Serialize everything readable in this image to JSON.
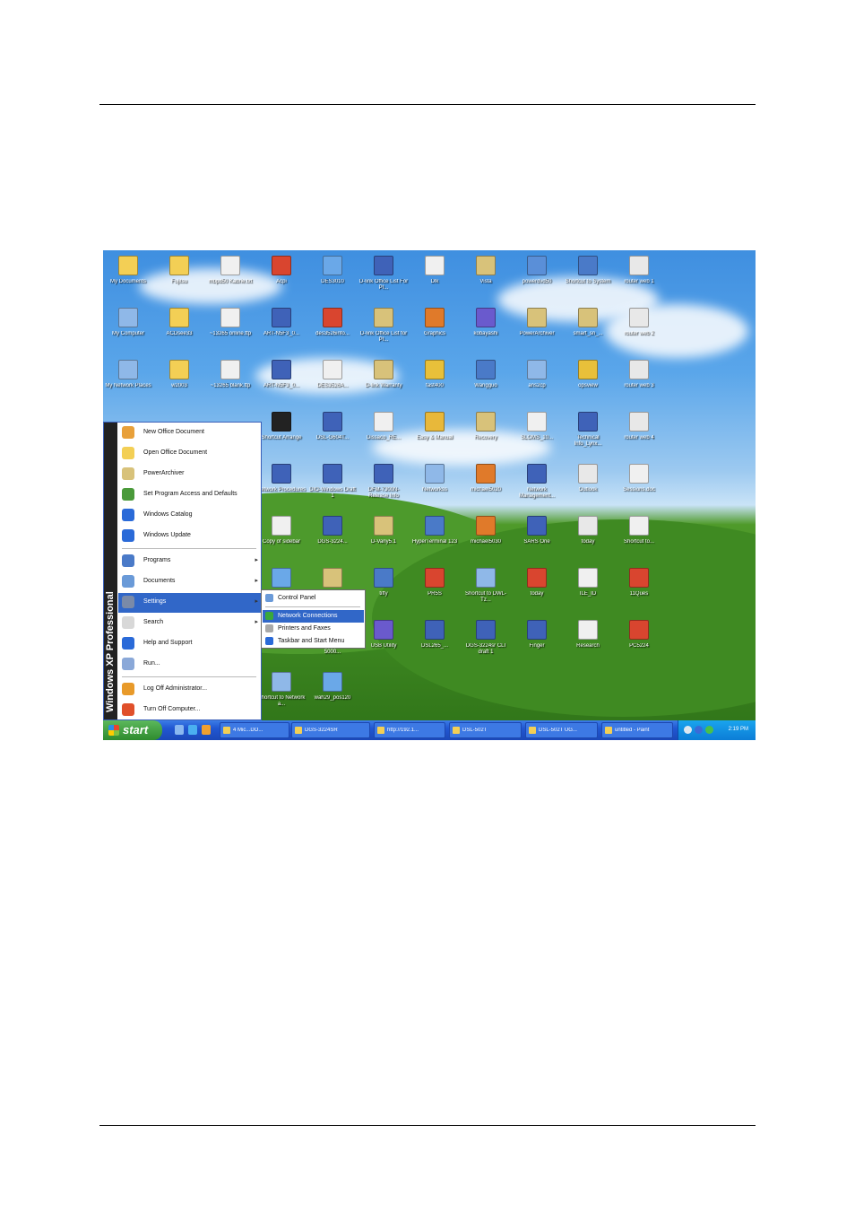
{
  "colors": {
    "desktop_sky": "#4a98e6",
    "desktop_grass": "#3f8a22",
    "taskbar": "#2157d2",
    "start_green": "#3f9e3f",
    "highlight": "#3167c8"
  },
  "desktop_icons": [
    {
      "label": "My Documents",
      "icon": "folder-icon",
      "color": "#f3cf55"
    },
    {
      "label": "Fujitsu",
      "icon": "folder-icon",
      "color": "#f3cf55"
    },
    {
      "label": "mbpd50 Kabrie.txt",
      "icon": "text-file-icon",
      "color": "#f0f0f0"
    },
    {
      "label": "Acpi",
      "icon": "pdf-icon",
      "color": "#d9452f"
    },
    {
      "label": "DES3010",
      "icon": "shortcut-icon",
      "color": "#6aa8e8"
    },
    {
      "label": "D-link Office List For PI...",
      "icon": "word-doc-icon",
      "color": "#3f62b8"
    },
    {
      "label": "Dlk",
      "icon": "text-file-icon",
      "color": "#f0f0f0"
    },
    {
      "label": "Vista",
      "icon": "image-icon",
      "color": "#d8c27a"
    },
    {
      "label": "powerdvd50",
      "icon": "app-icon",
      "color": "#5a8fd8"
    },
    {
      "label": "Shortcut to System",
      "icon": "monitor-icon",
      "color": "#4a7ac8"
    },
    {
      "label": "router web 1",
      "icon": "paint-icon",
      "color": "#e8e8e8"
    },
    {
      "label": "My Computer",
      "icon": "computer-icon",
      "color": "#8fb8e8"
    },
    {
      "label": "ACDsee33",
      "icon": "folder-icon",
      "color": "#f3cf55"
    },
    {
      "label": "~13265 online.ttp",
      "icon": "text-file-icon",
      "color": "#f0f0f0"
    },
    {
      "label": "ART-N5F3_0...",
      "icon": "word-doc-icon",
      "color": "#3f62b8"
    },
    {
      "label": "des3526info...",
      "icon": "pdf-icon",
      "color": "#d9452f"
    },
    {
      "label": "D-link Office List for PI...",
      "icon": "image-icon",
      "color": "#d8c27a"
    },
    {
      "label": "Graphics",
      "icon": "app-icon",
      "color": "#e07a2a"
    },
    {
      "label": "kobayashi",
      "icon": "app-icon",
      "color": "#6a5acd"
    },
    {
      "label": "PowerArchiver",
      "icon": "archive-icon",
      "color": "#d8c27a"
    },
    {
      "label": "smart_sn_...",
      "icon": "image-icon",
      "color": "#d8c27a"
    },
    {
      "label": "router web 2",
      "icon": "paint-icon",
      "color": "#e8e8e8"
    },
    {
      "label": "My Network Places",
      "icon": "network-icon",
      "color": "#8fb8e8"
    },
    {
      "label": "w2003",
      "icon": "folder-icon",
      "color": "#f3cf55"
    },
    {
      "label": "~13265 blank.ttp",
      "icon": "text-file-icon",
      "color": "#f0f0f0"
    },
    {
      "label": "ART-N5F3_0...",
      "icon": "word-doc-icon",
      "color": "#3f62b8"
    },
    {
      "label": "DES3526A...",
      "icon": "text-file-icon",
      "color": "#f0f0f0"
    },
    {
      "label": "D-link Warranty",
      "icon": "image-icon",
      "color": "#d8c27a"
    },
    {
      "label": "fast400",
      "icon": "app-icon",
      "color": "#e8c03a"
    },
    {
      "label": "Wangguo",
      "icon": "app-icon",
      "color": "#4a7ac8"
    },
    {
      "label": "ans2cp",
      "icon": "app-icon",
      "color": "#8fb8e8"
    },
    {
      "label": "opsview",
      "icon": "app-icon",
      "color": "#e8c03a"
    },
    {
      "label": "router web 3",
      "icon": "paint-icon",
      "color": "#e8e8e8"
    },
    {
      "label": "Shortcut Arrange",
      "icon": "cmd-icon",
      "color": "#222222"
    },
    {
      "label": "DSL-G604T...",
      "icon": "word-doc-icon",
      "color": "#3f62b8"
    },
    {
      "label": "Dissaco_RE...",
      "icon": "text-file-icon",
      "color": "#f0f0f0"
    },
    {
      "label": "Easy & Manual",
      "icon": "app-icon",
      "color": "#e8b83a"
    },
    {
      "label": "Recovery",
      "icon": "image-icon",
      "color": "#d8c27a"
    },
    {
      "label": "SLOMS_10...",
      "icon": "text-file-icon",
      "color": "#f0f0f0"
    },
    {
      "label": "Technical Info_Lynx...",
      "icon": "word-doc-icon",
      "color": "#3f62b8"
    },
    {
      "label": "router web 4",
      "icon": "paint-icon",
      "color": "#e8e8e8"
    },
    {
      "label": "Network Procedures",
      "icon": "word-doc-icon",
      "color": "#3f62b8"
    },
    {
      "label": "DIO-Windows Draft 1",
      "icon": "word-doc-icon",
      "color": "#3f62b8"
    },
    {
      "label": "DFM-7300N-Release Info",
      "icon": "word-doc-icon",
      "color": "#3f62b8"
    },
    {
      "label": "Networkss",
      "icon": "network-icon",
      "color": "#8fb8e8"
    },
    {
      "label": "michael5020",
      "icon": "app-icon",
      "color": "#e07a2a"
    },
    {
      "label": "Network Management...",
      "icon": "word-doc-icon",
      "color": "#3f62b8"
    },
    {
      "label": "Outlook",
      "icon": "paint-icon",
      "color": "#e8e8e8"
    },
    {
      "label": "Sessions.doc",
      "icon": "text-file-icon",
      "color": "#f0f0f0"
    },
    {
      "label": "Copy of sidebar",
      "icon": "text-file-icon",
      "color": "#f0f0f0"
    },
    {
      "label": "DGS-3224...",
      "icon": "word-doc-icon",
      "color": "#3f62b8"
    },
    {
      "label": "D-Vany5.1",
      "icon": "image-icon",
      "color": "#d8c27a"
    },
    {
      "label": "HyperTerminal 123",
      "icon": "app-icon",
      "color": "#4a7ac8"
    },
    {
      "label": "michael5030",
      "icon": "app-icon",
      "color": "#e07a2a"
    },
    {
      "label": "SARS One",
      "icon": "word-doc-icon",
      "color": "#3f62b8"
    },
    {
      "label": "today",
      "icon": "paint-icon",
      "color": "#e8e8e8"
    },
    {
      "label": "Shortcut to...",
      "icon": "text-file-icon",
      "color": "#f0f0f0"
    },
    {
      "label": "DES-3226...",
      "icon": "shortcut-icon",
      "color": "#6aa8e8"
    },
    {
      "label": "DSL-G604E",
      "icon": "image-icon",
      "color": "#d8c27a"
    },
    {
      "label": "tiffy",
      "icon": "app-icon",
      "color": "#4a7ac8"
    },
    {
      "label": "PR5S",
      "icon": "pdf-icon",
      "color": "#d9452f"
    },
    {
      "label": "Shortcut to DWL-Tz...",
      "icon": "network-icon",
      "color": "#8fb8e8"
    },
    {
      "label": "today",
      "icon": "pdf-icon",
      "color": "#d9452f"
    },
    {
      "label": "ILE_ID",
      "icon": "text-file-icon",
      "color": "#f0f0f0"
    },
    {
      "label": "11Ques",
      "icon": "pdf-icon",
      "color": "#d9452f"
    },
    {
      "label": "PC5240",
      "icon": "pdf-icon",
      "color": "#d9452f"
    },
    {
      "label": "Shortcut to DWL-5000...",
      "icon": "folder-icon",
      "color": "#f3cf55"
    },
    {
      "label": "USB Utility",
      "icon": "app-icon",
      "color": "#6a5acd"
    },
    {
      "label": "DSL265_...",
      "icon": "word-doc-icon",
      "color": "#3f62b8"
    },
    {
      "label": "DGS-3224sr CLI draft 1",
      "icon": "word-doc-icon",
      "color": "#3f62b8"
    },
    {
      "label": "Finger",
      "icon": "word-doc-icon",
      "color": "#3f62b8"
    },
    {
      "label": "Research",
      "icon": "text-file-icon",
      "color": "#f0f0f0"
    },
    {
      "label": "PC5224",
      "icon": "pdf-icon",
      "color": "#d9452f"
    },
    {
      "label": "Shortcut to Network a...",
      "icon": "network-icon",
      "color": "#8fb8e8"
    },
    {
      "label": "wah29_pos120",
      "icon": "shortcut-icon",
      "color": "#6aa8e8"
    }
  ],
  "start_menu": {
    "band_label": "Windows XP Professional",
    "items": [
      {
        "label": "New Office Document",
        "icon": "office-icon",
        "color": "#e8a03a"
      },
      {
        "label": "Open Office Document",
        "icon": "folder-open-icon",
        "color": "#f3cf55"
      },
      {
        "label": "PowerArchiver",
        "icon": "archive-icon",
        "color": "#d8c27a"
      },
      {
        "label": "Set Program Access and Defaults",
        "icon": "globe-icon",
        "color": "#4a9a3a"
      },
      {
        "label": "Windows Catalog",
        "icon": "catalog-icon",
        "color": "#2a6ad8"
      },
      {
        "label": "Windows Update",
        "icon": "update-icon",
        "color": "#2a6ad8"
      },
      {
        "label": "Programs",
        "icon": "programs-icon",
        "color": "#4a7ac8",
        "arrow": "▸"
      },
      {
        "label": "Documents",
        "icon": "documents-icon",
        "color": "#6a9ad8",
        "arrow": "▸"
      },
      {
        "label": "Settings",
        "icon": "settings-icon",
        "color": "#7a8aa8",
        "arrow": "▸"
      },
      {
        "label": "Search",
        "icon": "search-icon",
        "color": "#d8d8d8",
        "arrow": "▸"
      },
      {
        "label": "Help and Support",
        "icon": "help-icon",
        "color": "#2a6ad8"
      },
      {
        "label": "Run...",
        "icon": "run-icon",
        "color": "#8aa8d8"
      },
      {
        "label": "Log Off Administrator...",
        "icon": "log-off-icon",
        "color": "#e89a2a"
      },
      {
        "label": "Turn Off Computer...",
        "icon": "power-icon",
        "color": "#e0502a"
      }
    ]
  },
  "settings_submenu": {
    "items": [
      {
        "label": "Control Panel",
        "icon": "control-panel-icon",
        "color": "#6a9ad8"
      },
      {
        "label": "Network Connections",
        "icon": "network-connections-icon",
        "color": "#3aa83a"
      },
      {
        "label": "Printers and Faxes",
        "icon": "printer-icon",
        "color": "#a8a8a8"
      },
      {
        "label": "Taskbar and Start Menu",
        "icon": "taskbar-icon",
        "color": "#2a6ad8"
      }
    ]
  },
  "taskbar": {
    "start_label": "start",
    "buttons": [
      {
        "label": "4 Mic...DO...",
        "icon": "window-icon"
      },
      {
        "label": "DGS-3224SR",
        "icon": "folder-icon"
      },
      {
        "label": "http://192.1...",
        "icon": "browser-icon"
      },
      {
        "label": "DSL-502T",
        "icon": "folder-icon"
      },
      {
        "label": "DSL-502T UG...",
        "icon": "word-doc-icon"
      },
      {
        "label": "untitled - Paint",
        "icon": "paint-icon"
      }
    ],
    "clock": "2:19 PM"
  }
}
